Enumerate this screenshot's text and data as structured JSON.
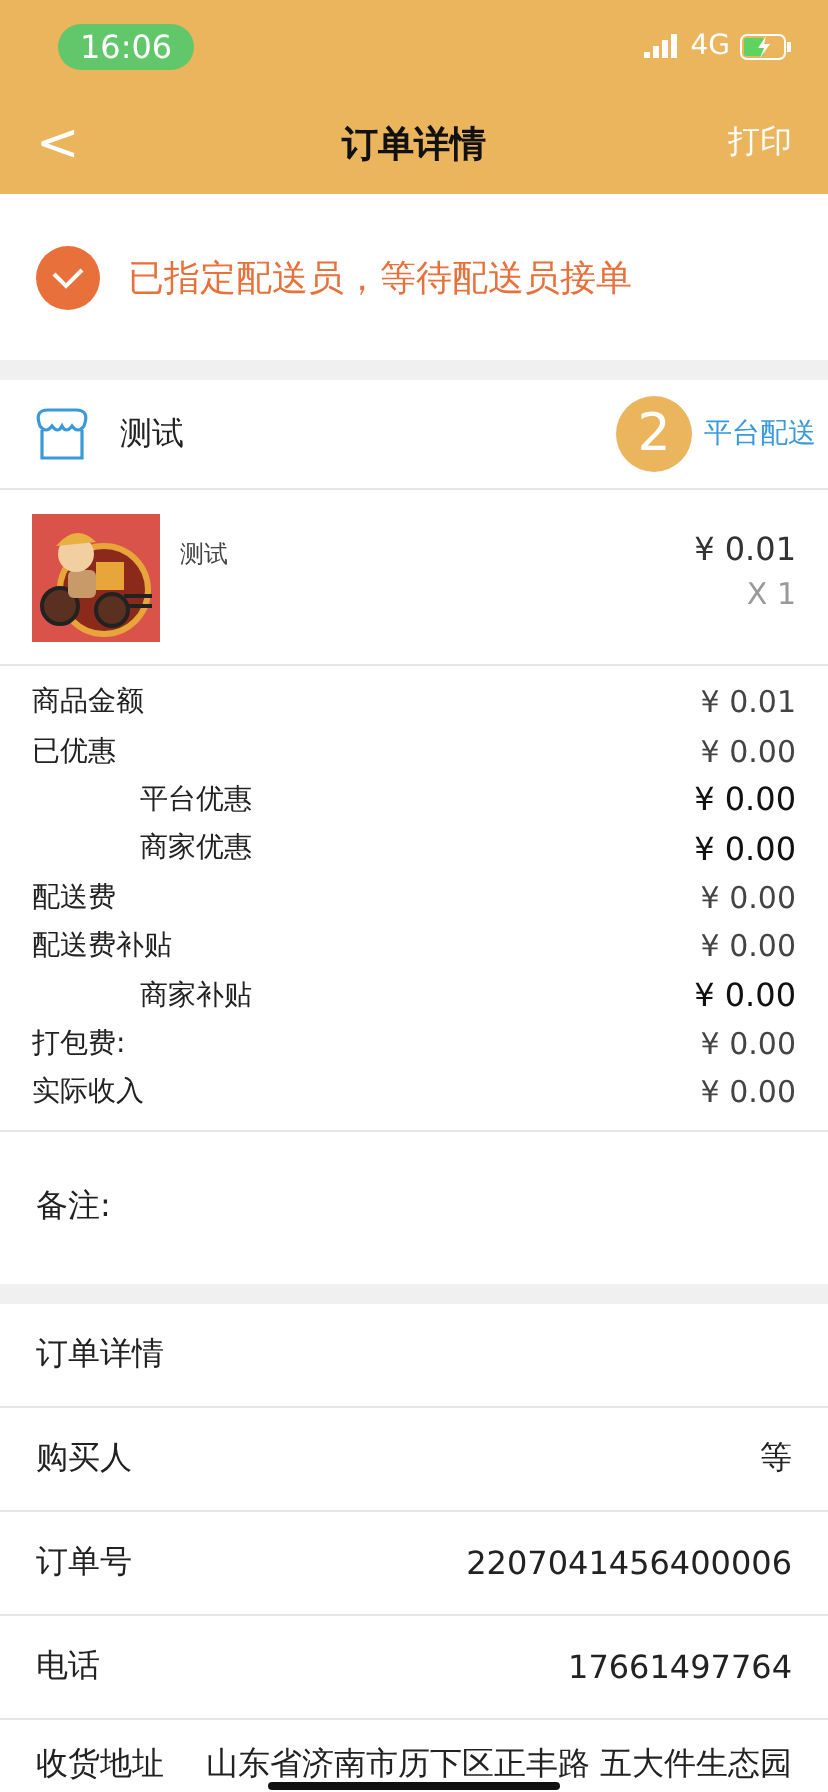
{
  "status_bar": {
    "time": "16:06",
    "network": "4G"
  },
  "nav": {
    "back": "<",
    "title": "订单详情",
    "action": "打印"
  },
  "order_status": {
    "text": "已指定配送员，等待配送员接单"
  },
  "shop": {
    "name": "测试",
    "badge": "2",
    "delivery": "平台配送"
  },
  "products": [
    {
      "name": "测试",
      "price": "¥ 0.01",
      "quantity": "X 1",
      "kind": "picture"
    }
  ],
  "fees": [
    {
      "label": "商品金额",
      "value": "¥ 0.01",
      "kind": "main"
    },
    {
      "label": "已优惠",
      "value": "¥ 0.00",
      "kind": "main"
    },
    {
      "label": "平台优惠",
      "value": "¥ 0.00",
      "kind": "sub"
    },
    {
      "label": "商家优惠",
      "value": "¥ 0.00",
      "kind": "sub"
    },
    {
      "label": "配送费",
      "value": "¥ 0.00",
      "kind": "main"
    },
    {
      "label": "配送费补贴",
      "value": "¥ 0.00",
      "kind": "main"
    },
    {
      "label": "商家补贴",
      "value": "¥ 0.00",
      "kind": "sub"
    },
    {
      "label": "打包费:",
      "value": "¥ 0.00",
      "kind": "main"
    },
    {
      "label": "实际收入",
      "value": "¥ 0.00",
      "kind": "main"
    }
  ],
  "remark": {
    "label": "备注:"
  },
  "details": {
    "title": "订单详情",
    "rows": [
      {
        "label": "购买人",
        "value": "等"
      },
      {
        "label": "订单号",
        "value": "2207041456400006"
      },
      {
        "label": "电话",
        "value": "17661497764"
      },
      {
        "label": "收货地址",
        "value": "山东省济南市历下区正丰路 五大件生态园"
      }
    ]
  }
}
